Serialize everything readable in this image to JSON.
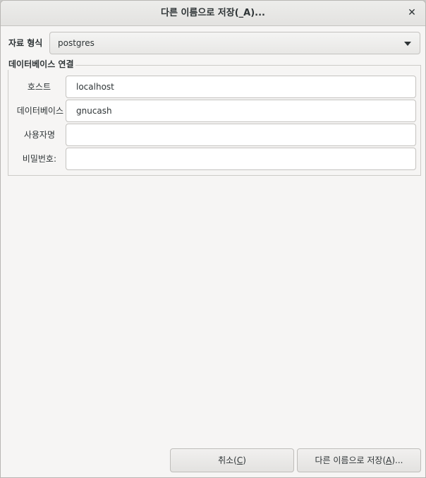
{
  "dialog": {
    "title": "다른 이름으로 저장(_A)..."
  },
  "format": {
    "label": "자료 형식",
    "selected": "postgres"
  },
  "connection": {
    "legend": "데이터베이스 연결",
    "host": {
      "label": "호스트",
      "value": "localhost"
    },
    "database": {
      "label": "데이터베이스",
      "value": "gnucash"
    },
    "username": {
      "label": "사용자명",
      "value": ""
    },
    "password": {
      "label": "비밀번호:",
      "value": ""
    }
  },
  "buttons": {
    "cancel": {
      "prefix": "취소(",
      "mnemonic": "C",
      "suffix": ")"
    },
    "save_as": {
      "prefix": "다른 이름으로 저장(",
      "mnemonic": "A",
      "suffix": ")..."
    }
  }
}
